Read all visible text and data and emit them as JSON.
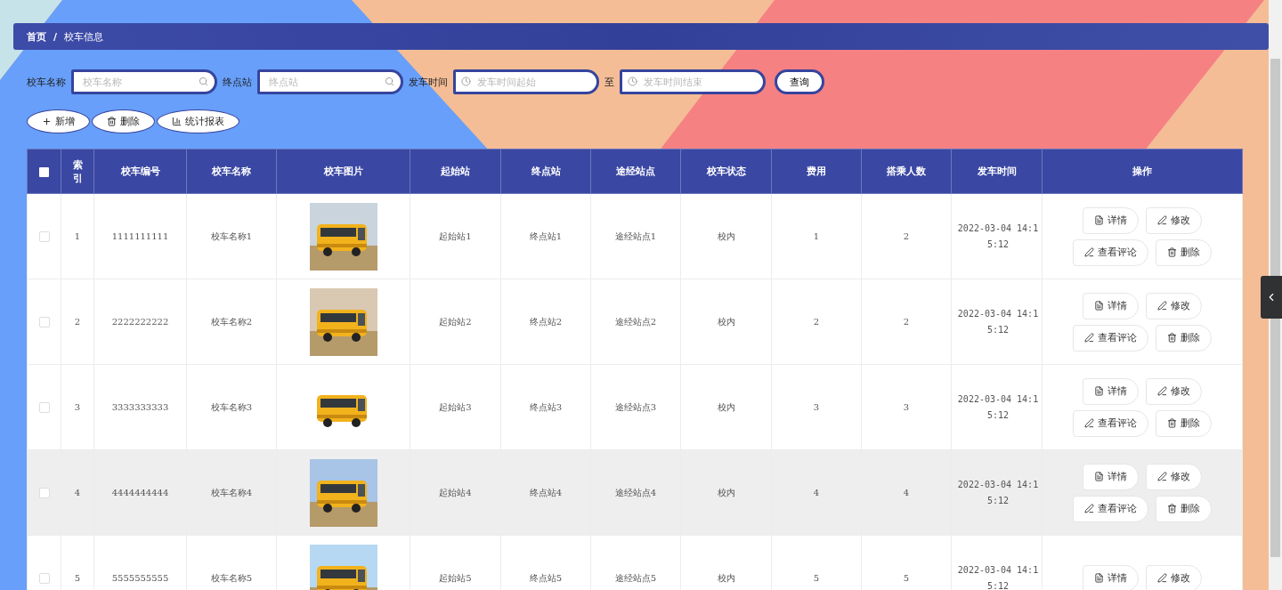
{
  "breadcrumb": [
    {
      "label": "首页",
      "current": false
    },
    {
      "label": "校车信息",
      "current": true
    }
  ],
  "breadcrumb_separator": "/",
  "search": {
    "fields": [
      {
        "label": "校车名称",
        "placeholder": "校车名称",
        "kind": "text"
      },
      {
        "label": "终点站",
        "placeholder": "终点站",
        "kind": "text"
      },
      {
        "label": "发车时间",
        "placeholder": "发车时间起始",
        "kind": "time"
      }
    ],
    "range_separator": "至",
    "range_end": {
      "placeholder": "发车时间结束",
      "kind": "time"
    },
    "submit": "查询"
  },
  "toolbar": [
    {
      "label": "新增",
      "kind": "add"
    },
    {
      "label": "删除",
      "kind": "delete"
    },
    {
      "label": "统计报表",
      "kind": "chart"
    }
  ],
  "table": {
    "select_all": {
      "checked": false
    },
    "columns": [
      "索引",
      "校车编号",
      "校车名称",
      "校车图片",
      "起始站",
      "终点站",
      "途经站点",
      "校车状态",
      "费用",
      "搭乘人数",
      "发车时间",
      "操作"
    ],
    "rows": [
      {
        "checked": false,
        "hovered": false,
        "index": "1",
        "number": "1111111111",
        "name": "校车名称1",
        "picture": {
          "kind": "picture"
        },
        "start": "起始站1",
        "end": "终点站1",
        "via": "途经站点1",
        "status": "校内",
        "fee": "1",
        "riders": "2",
        "time": "2022-03-04 14:15:12",
        "actions": [
          {
            "label": "详情",
            "kind": "detail"
          },
          {
            "label": "修改",
            "kind": "edit"
          },
          {
            "label": "查看评论",
            "kind": "edit"
          },
          {
            "label": "删除",
            "kind": "delete"
          }
        ]
      },
      {
        "checked": false,
        "hovered": false,
        "index": "2",
        "number": "2222222222",
        "name": "校车名称2",
        "picture": {
          "kind": "picture"
        },
        "start": "起始站2",
        "end": "终点站2",
        "via": "途经站点2",
        "status": "校内",
        "fee": "2",
        "riders": "2",
        "time": "2022-03-04 14:15:12",
        "actions": [
          {
            "label": "详情",
            "kind": "detail"
          },
          {
            "label": "修改",
            "kind": "edit"
          },
          {
            "label": "查看评论",
            "kind": "edit"
          },
          {
            "label": "删除",
            "kind": "delete"
          }
        ]
      },
      {
        "checked": false,
        "hovered": false,
        "index": "3",
        "number": "3333333333",
        "name": "校车名称3",
        "picture": {
          "kind": "picture"
        },
        "start": "起始站3",
        "end": "终点站3",
        "via": "途经站点3",
        "status": "校内",
        "fee": "3",
        "riders": "3",
        "time": "2022-03-04 14:15:12",
        "actions": [
          {
            "label": "详情",
            "kind": "detail"
          },
          {
            "label": "修改",
            "kind": "edit"
          },
          {
            "label": "查看评论",
            "kind": "edit"
          },
          {
            "label": "删除",
            "kind": "delete"
          }
        ]
      },
      {
        "checked": false,
        "hovered": true,
        "index": "4",
        "number": "4444444444",
        "name": "校车名称4",
        "picture": {
          "kind": "picture"
        },
        "start": "起始站4",
        "end": "终点站4",
        "via": "途经站点4",
        "status": "校内",
        "fee": "4",
        "riders": "4",
        "time": "2022-03-04 14:15:12",
        "actions": [
          {
            "label": "详情",
            "kind": "detail"
          },
          {
            "label": "修改",
            "kind": "edit"
          },
          {
            "label": "查看评论",
            "kind": "edit"
          },
          {
            "label": "删除",
            "kind": "delete"
          }
        ]
      },
      {
        "checked": false,
        "hovered": false,
        "index": "5",
        "number": "5555555555",
        "name": "校车名称5",
        "picture": {
          "kind": "picture"
        },
        "start": "起始站5",
        "end": "终点站5",
        "via": "途经站点5",
        "status": "校内",
        "fee": "5",
        "riders": "5",
        "time": "2022-03-04 14:15:12",
        "actions": [
          {
            "label": "详情",
            "kind": "detail"
          },
          {
            "label": "修改",
            "kind": "edit"
          }
        ]
      }
    ]
  }
}
